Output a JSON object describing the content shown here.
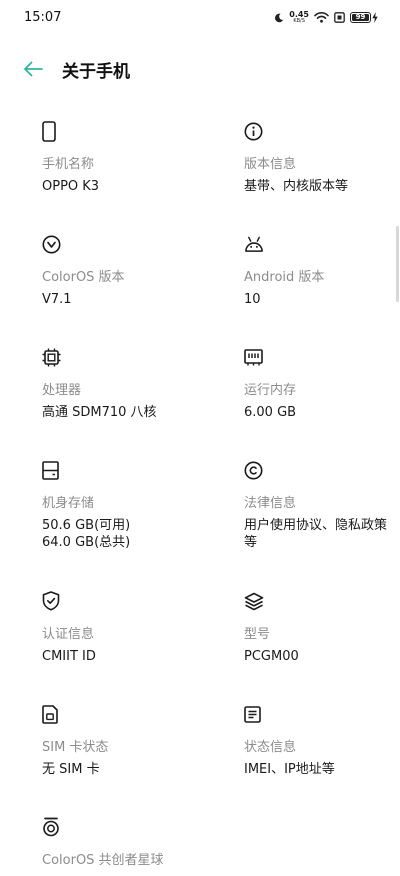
{
  "status_bar": {
    "time": "15:07",
    "net_speed_value": "0.45",
    "net_speed_unit": "KB/S",
    "battery_level": "99"
  },
  "header": {
    "title": "关于手机"
  },
  "colors": {
    "accent": "#2fb6a0",
    "label_gray": "#8c8c8c"
  },
  "items": [
    {
      "icon": "phone-icon",
      "label": "手机名称",
      "value": "OPPO K3"
    },
    {
      "icon": "info-icon",
      "label": "版本信息",
      "value": "基带、内核版本等"
    },
    {
      "icon": "coloros-icon",
      "label": "ColorOS 版本",
      "value": "V7.1"
    },
    {
      "icon": "android-icon",
      "label": "Android 版本",
      "value": "10"
    },
    {
      "icon": "processor-icon",
      "label": "处理器",
      "value": "高通 SDM710 八核"
    },
    {
      "icon": "memory-icon",
      "label": "运行内存",
      "value": "6.00 GB"
    },
    {
      "icon": "storage-icon",
      "label": "机身存储",
      "value": "50.6 GB(可用)\n64.0 GB(总共)"
    },
    {
      "icon": "copyright-icon",
      "label": "法律信息",
      "value": "用户使用协议、隐私政策\n等"
    },
    {
      "icon": "shield-check-icon",
      "label": "认证信息",
      "value": "CMIIT ID"
    },
    {
      "icon": "layers-icon",
      "label": "型号",
      "value": "PCGM00"
    },
    {
      "icon": "sim-card-icon",
      "label": "SIM 卡状态",
      "value": "无 SIM 卡"
    },
    {
      "icon": "document-icon",
      "label": "状态信息",
      "value": "IMEI、IP地址等"
    },
    {
      "icon": "coloros-creators-icon",
      "label": "ColorOS 共创者星球",
      "value": ""
    }
  ]
}
